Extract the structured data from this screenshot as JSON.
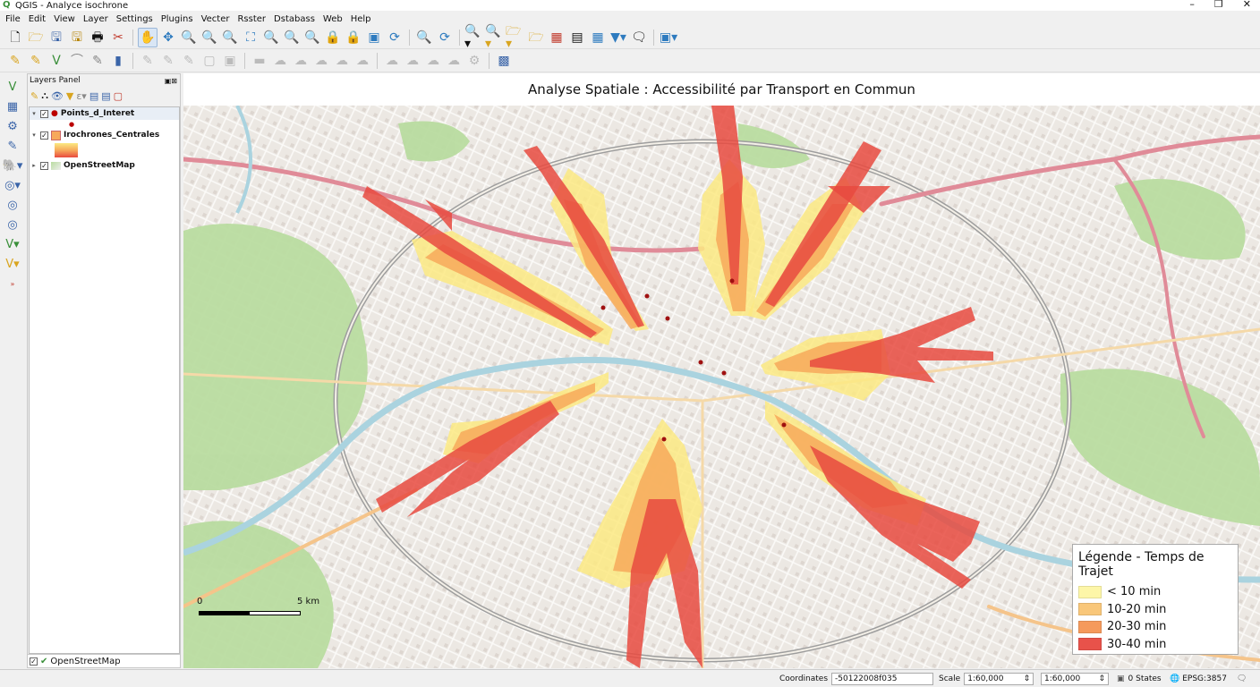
{
  "window": {
    "title": "QGIS - Analyce isochrone",
    "minimize": "–",
    "maximize": "❐",
    "close": "✕"
  },
  "menu": [
    "File",
    "Edit",
    "View",
    "Layer",
    "Settings",
    "Plugins",
    "Vecter",
    "Rsster",
    "Dstabass",
    "Web",
    "Help"
  ],
  "layers_panel": {
    "title": "Layers Panel",
    "layers": [
      {
        "name": "Points_d_Interet",
        "checked": true
      },
      {
        "name": "Irochrones_Centrales",
        "checked": true
      },
      {
        "name": "OpenStreetMap",
        "checked": true
      }
    ],
    "bottom_tab": "OpenStreetMap"
  },
  "map": {
    "title": "Analyse Spatiale : Accessibilité par Transport en Commun",
    "legend": {
      "title": "Légende - Temps de Trajet",
      "items": [
        {
          "label": "< 10 min",
          "color": "#fdf6a8"
        },
        {
          "label": "10-20 min",
          "color": "#f9c77a"
        },
        {
          "label": "20-30 min",
          "color": "#f59a5c"
        },
        {
          "label": "30-40 min",
          "color": "#e8524a"
        }
      ]
    },
    "scalebar": {
      "start": "0",
      "end": "5 km"
    }
  },
  "statusbar": {
    "coordinates_label": "Coordinates",
    "coordinates_value": "-50122008f035",
    "scale_label": "Scale",
    "scale_value": "1:60,000",
    "scale_value2": "1:60,000",
    "states": "0 States",
    "crs": "EPSG:3857"
  },
  "colors": {
    "iso_yellow": "#fbe983",
    "iso_orange": "#f7a95b",
    "iso_red": "#e84a3f",
    "water": "#aad3df",
    "park": "#b9dca0"
  }
}
